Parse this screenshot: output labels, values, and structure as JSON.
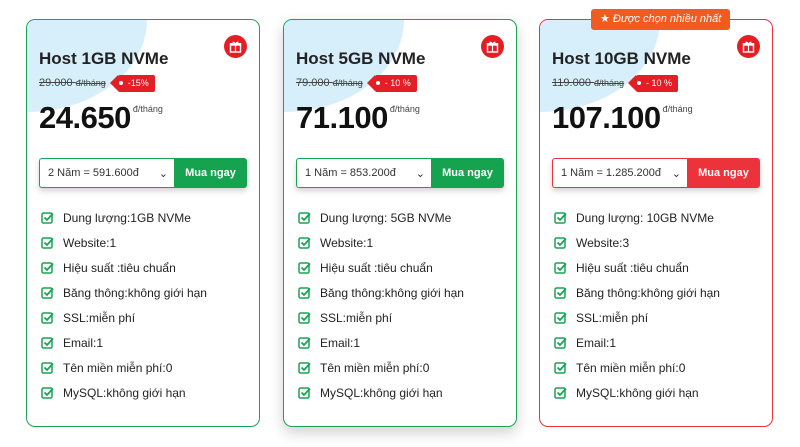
{
  "cards": [
    {
      "title": "Host 1GB NVMe",
      "old_price": "29.000",
      "old_unit": "đ/tháng",
      "discount": "-15%",
      "price": "24.650",
      "price_unit": "đ/tháng",
      "select_value": "2 Năm = 591.600đ",
      "buy_label": "Mua ngay",
      "features": [
        "Dung lượng:1GB NVMe",
        "Website:1",
        "Hiệu suất :tiêu chuẩn",
        "Băng thông:không giới hạn",
        "SSL:miễn phí",
        "Email:1",
        "Tên miền miễn phí:0",
        "MySQL:không giới hạn"
      ]
    },
    {
      "title": "Host 5GB NVMe",
      "old_price": "79.000",
      "old_unit": "đ/tháng",
      "discount": "- 10 %",
      "price": "71.100",
      "price_unit": "đ/tháng",
      "select_value": "1 Năm = 853.200đ",
      "buy_label": "Mua ngay",
      "features": [
        "Dung lượng: 5GB NVMe",
        "Website:1",
        "Hiệu suất :tiêu chuẩn",
        "Băng thông:không giới hạn",
        "SSL:miễn phí",
        "Email:1",
        "Tên miền miễn phí:0",
        "MySQL:không giới hạn"
      ]
    },
    {
      "badge": "Được chọn nhiều nhất",
      "title": "Host 10GB NVMe",
      "old_price": "119.000",
      "old_unit": "đ/tháng",
      "discount": "- 10 %",
      "price": "107.100",
      "price_unit": "đ/tháng",
      "select_value": "1 Năm = 1.285.200đ",
      "buy_label": "Mua ngay",
      "features": [
        "Dung lượng: 10GB NVMe",
        "Website:3",
        "Hiệu suất :tiêu chuẩn",
        "Băng thông:không giới hạn",
        "SSL:miễn phí",
        "Email:1",
        "Tên miền miễn phí:0",
        "MySQL:không giới hạn"
      ]
    }
  ],
  "icons": {
    "gift": "gift-icon",
    "feature": "check-square-icon",
    "badge": "star-icon",
    "select": "chevron-down-icon"
  },
  "colors": {
    "green": "#16a350",
    "red": "#ec323b",
    "orange": "#f25b1f",
    "blob": "#d6effb"
  }
}
